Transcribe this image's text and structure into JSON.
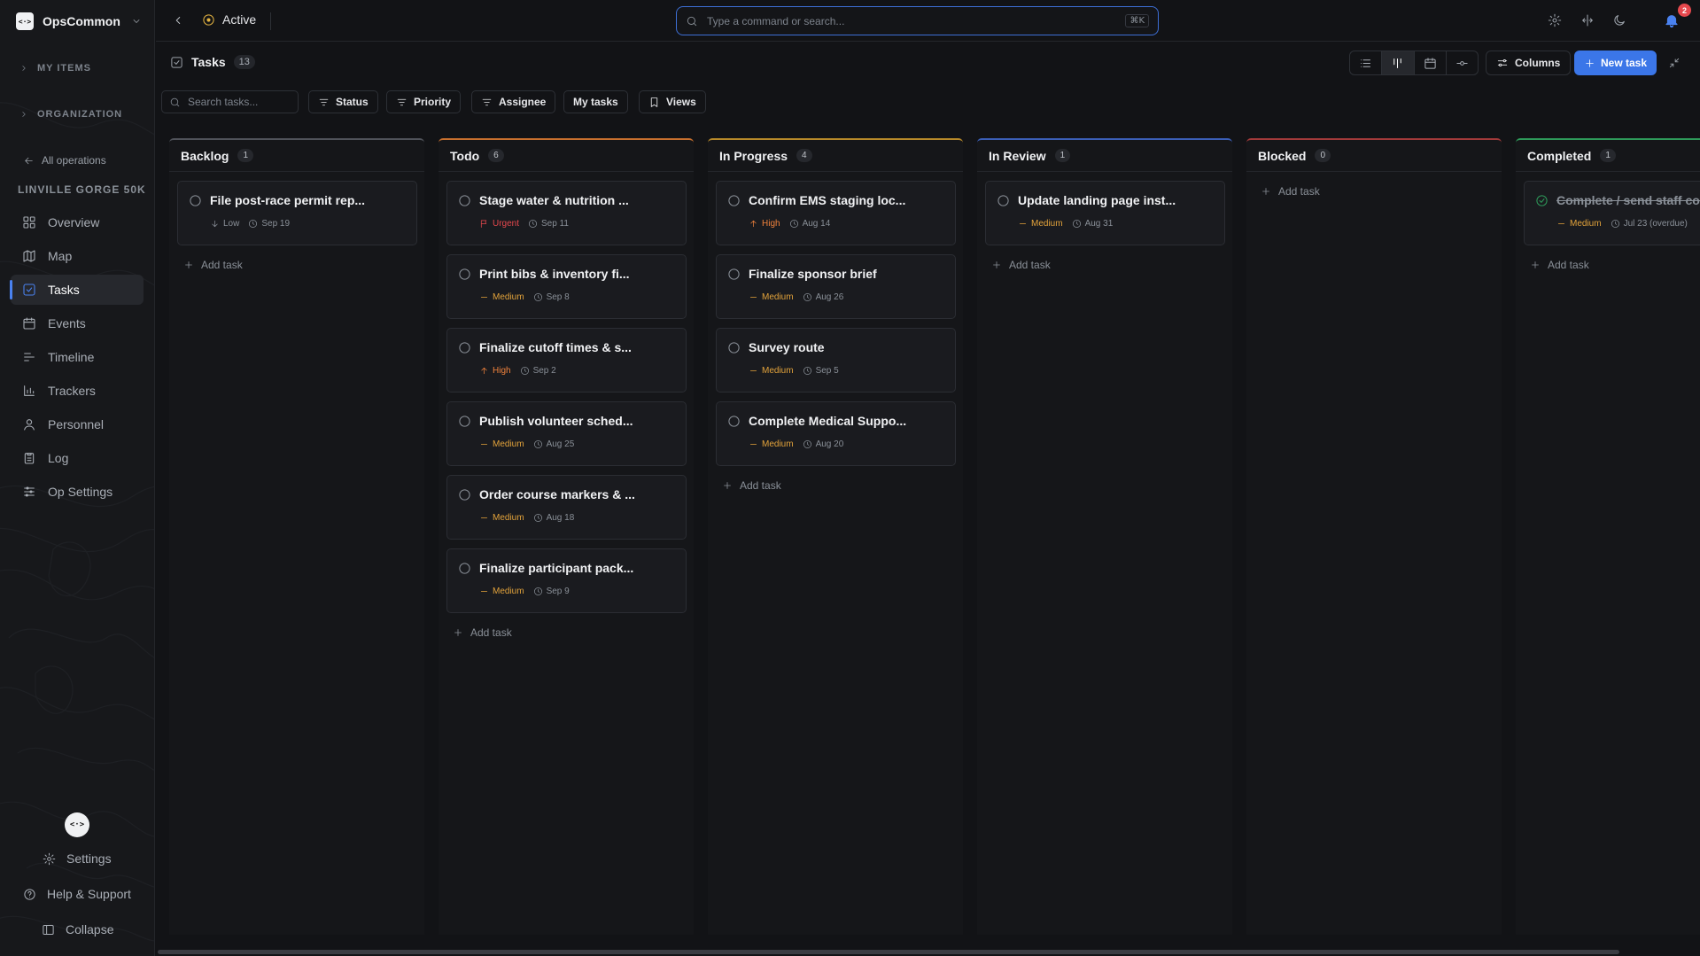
{
  "sidebar": {
    "brand": "OpsCommon",
    "logo": "<·>",
    "groups": [
      {
        "label": "MY ITEMS"
      },
      {
        "label": "ORGANIZATION"
      }
    ],
    "back_link": "All operations",
    "operation_name": "LINVILLE GORGE 50K",
    "nav": [
      {
        "label": "Overview",
        "icon": "grid-icon"
      },
      {
        "label": "Map",
        "icon": "map-icon"
      },
      {
        "label": "Tasks",
        "icon": "checkbox-icon",
        "active": true
      },
      {
        "label": "Events",
        "icon": "calendar-icon"
      },
      {
        "label": "Timeline",
        "icon": "timeline-icon"
      },
      {
        "label": "Trackers",
        "icon": "bar-chart-icon"
      },
      {
        "label": "Personnel",
        "icon": "user-icon"
      },
      {
        "label": "Log",
        "icon": "clipboard-icon"
      },
      {
        "label": "Op Settings",
        "icon": "sliders-icon"
      }
    ],
    "bottom": {
      "settings": "Settings",
      "help": "Help & Support",
      "collapse": "Collapse"
    }
  },
  "topbar": {
    "status": "Active",
    "search_placeholder": "Type a command or search...",
    "shortcut": "⌘K",
    "notification_count": "2"
  },
  "header": {
    "title": "Tasks",
    "count": "13",
    "columns_label": "Columns",
    "new_task_label": "New task"
  },
  "filters": {
    "search_placeholder": "Search tasks...",
    "status": "Status",
    "priority": "Priority",
    "assignee": "Assignee",
    "my_tasks": "My tasks",
    "views": "Views"
  },
  "colors": {
    "accent": "#3b76e8",
    "urgent": "#e5484d",
    "high": "#f0823c",
    "medium": "#e3a33b",
    "low": "#8a9098",
    "backlog": "#50535a",
    "todo": "#c8702e",
    "in_progress": "#b88a2a",
    "in_review": "#3b5fb8",
    "blocked": "#a33a3a",
    "completed": "#2e9b5a"
  },
  "add_task_label": "Add task",
  "columns": [
    {
      "id": "backlog",
      "title": "Backlog",
      "count": "1",
      "cards": [
        {
          "title": "File post-race permit rep...",
          "priority": "Low",
          "due": "Sep 19"
        }
      ]
    },
    {
      "id": "todo",
      "title": "Todo",
      "count": "6",
      "cards": [
        {
          "title": "Stage water & nutrition ...",
          "priority": "Urgent",
          "due": "Sep 11"
        },
        {
          "title": "Print bibs & inventory fi...",
          "priority": "Medium",
          "due": "Sep 8"
        },
        {
          "title": "Finalize cutoff times & s...",
          "priority": "High",
          "due": "Sep 2"
        },
        {
          "title": "Publish volunteer sched...",
          "priority": "Medium",
          "due": "Aug 25"
        },
        {
          "title": "Order course markers & ...",
          "priority": "Medium",
          "due": "Aug 18"
        },
        {
          "title": "Finalize participant pack...",
          "priority": "Medium",
          "due": "Sep 9"
        }
      ]
    },
    {
      "id": "in_progress",
      "title": "In Progress",
      "count": "4",
      "cards": [
        {
          "title": "Confirm EMS staging loc...",
          "priority": "High",
          "due": "Aug 14"
        },
        {
          "title": "Finalize sponsor brief",
          "priority": "Medium",
          "due": "Aug 26"
        },
        {
          "title": "Survey route",
          "priority": "Medium",
          "due": "Sep 5"
        },
        {
          "title": "Complete Medical Suppo...",
          "priority": "Medium",
          "due": "Aug 20"
        }
      ]
    },
    {
      "id": "in_review",
      "title": "In Review",
      "count": "1",
      "cards": [
        {
          "title": "Update landing page inst...",
          "priority": "Medium",
          "due": "Aug 31"
        }
      ]
    },
    {
      "id": "blocked",
      "title": "Blocked",
      "count": "0",
      "cards": []
    },
    {
      "id": "completed",
      "title": "Completed",
      "count": "1",
      "cards": [
        {
          "title": "Complete / send staff co...",
          "priority": "Medium",
          "due": "Jul 23 (overdue)",
          "done": true
        }
      ]
    }
  ]
}
